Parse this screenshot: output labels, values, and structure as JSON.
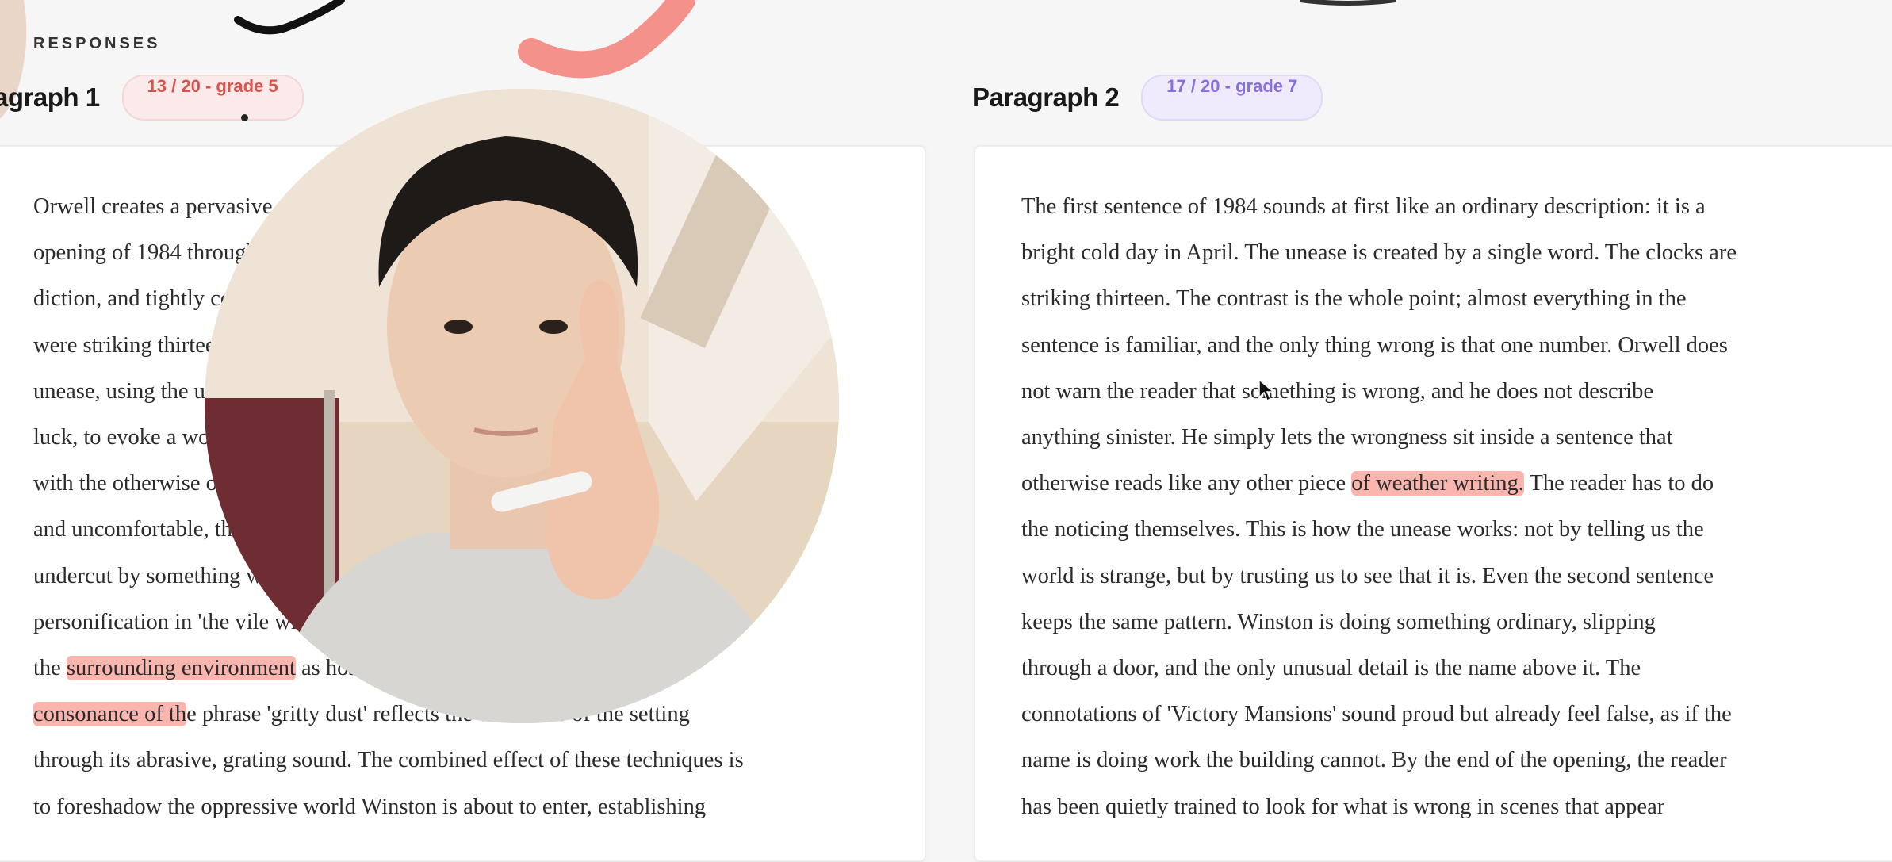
{
  "section_label": "RESPONSES",
  "paragraph1": {
    "title": "agraph 1",
    "badge": "13 / 20 - grade 5",
    "lines": [
      "Orwell creates a pervasive sense of unease in the",
      "opening of 1984 through ominous",
      "diction, and tightly controlled clocks",
      "were striking thirteen, immediately creating",
      "unease, using the unlucky number thirteen, bad",
      "luck, to evoke a world where something is",
      "with the otherwise ordinary spring",
      "and uncomfortable, the everyday",
      "undercut by something wrong",
      "personification in 'the vile wind' presenting",
      {
        "before": "the ",
        "highlight": "surrounding environment",
        "after": " as hostile, while the harsh"
      },
      {
        "before": "",
        "highlight": "consonance of th",
        "after": "e phrase 'gritty dust' reflects the bleakness of the setting"
      },
      "through its abrasive, grating sound. The combined effect of these techniques is",
      "to foreshadow the oppressive world Winston is about to enter, establishing"
    ]
  },
  "paragraph2": {
    "title": "Paragraph 2",
    "badge": "17 / 20 - grade 7",
    "lines": [
      "The first sentence of 1984 sounds at first like an ordinary description: it is a",
      "bright cold day in April. The unease is created by a single word. The clocks are",
      "striking thirteen. The contrast is the whole point; almost everything in the",
      "sentence is familiar, and the only thing wrong is that one number. Orwell does",
      "not warn the reader that something is wrong, and he does not describe",
      "anything sinister. He simply lets the wrongness sit inside a sentence that",
      {
        "before": "otherwise reads like any other piece ",
        "highlight": "of weather writing.",
        "after": " The reader has to do"
      },
      "the noticing themselves. This is how the unease works: not by telling us the",
      "world is strange, but by trusting us to see that it is. Even the second sentence",
      "keeps the same pattern. Winston is doing something ordinary, slipping",
      "through a door, and the only unusual detail is the name above it. The",
      "connotations of 'Victory Mansions' sound proud but already feel false, as if the",
      "name is doing work the building cannot. By the end of the opening, the reader",
      "has been quietly trained to look for what is wrong in scenes that appear"
    ]
  },
  "colors": {
    "highlight": "#f8786e",
    "badge_red_text": "#d9534b",
    "badge_purple_text": "#8a6fe0",
    "annotation_stroke": "#f4918a"
  },
  "icons": [
    "mouse-cursor-icon"
  ],
  "overlay": {
    "type": "webcam",
    "shape": "circle"
  }
}
